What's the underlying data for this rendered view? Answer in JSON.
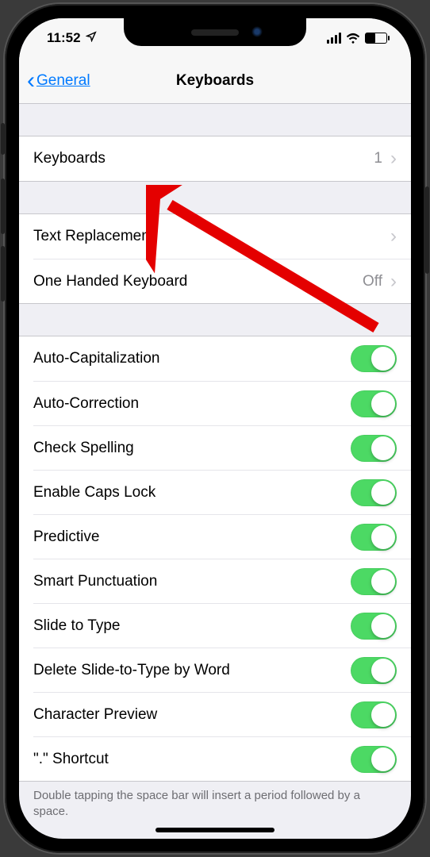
{
  "status": {
    "time": "11:52"
  },
  "nav": {
    "back_label": "General",
    "title": "Keyboards"
  },
  "group1": {
    "keyboards": {
      "label": "Keyboards",
      "value": "1"
    }
  },
  "group2": {
    "text_replacement": {
      "label": "Text Replacement"
    },
    "one_handed": {
      "label": "One Handed Keyboard",
      "value": "Off"
    }
  },
  "toggles": [
    {
      "label": "Auto-Capitalization",
      "on": true
    },
    {
      "label": "Auto-Correction",
      "on": true
    },
    {
      "label": "Check Spelling",
      "on": true
    },
    {
      "label": "Enable Caps Lock",
      "on": true
    },
    {
      "label": "Predictive",
      "on": true
    },
    {
      "label": "Smart Punctuation",
      "on": true
    },
    {
      "label": "Slide to Type",
      "on": true
    },
    {
      "label": "Delete Slide-to-Type by Word",
      "on": true
    },
    {
      "label": "Character Preview",
      "on": true
    },
    {
      "label": "\".\" Shortcut",
      "on": true
    }
  ],
  "footer": "Double tapping the space bar will insert a period followed by a space."
}
